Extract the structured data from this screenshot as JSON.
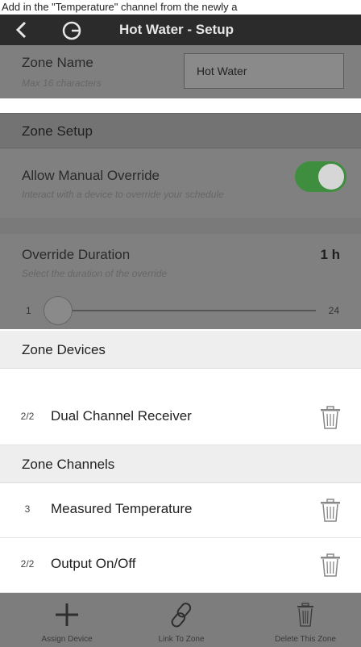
{
  "instruction": "Add in the \"Temperature\" channel from the newly a",
  "header": {
    "title": "Hot Water - Setup"
  },
  "zone_name": {
    "label": "Zone Name",
    "hint": "Max 16 characters",
    "value": "Hot Water"
  },
  "zone_setup": {
    "header": "Zone Setup"
  },
  "manual_override": {
    "label": "Allow Manual Override",
    "hint": "Interact with a device to override your schedule",
    "enabled": true
  },
  "override_duration": {
    "label": "Override Duration",
    "hint": "Select the duration of the override",
    "value": "1 h",
    "min": "1",
    "max": "24"
  },
  "zone_devices": {
    "header": "Zone Devices",
    "items": [
      {
        "badge": "2/2",
        "name": "Dual Channel Receiver"
      }
    ]
  },
  "zone_channels": {
    "header": "Zone Channels",
    "items": [
      {
        "badge": "3",
        "name": "Measured Temperature"
      },
      {
        "badge": "2/2",
        "name": "Output On/Off"
      }
    ]
  },
  "bottom_bar": {
    "assign_label": "Assign Device",
    "link_label": "Link To Zone",
    "delete_label": "Delete This Zone"
  },
  "colors": {
    "toggle_on": "#3f8e3f",
    "app_bar": "#2b2b2b"
  }
}
